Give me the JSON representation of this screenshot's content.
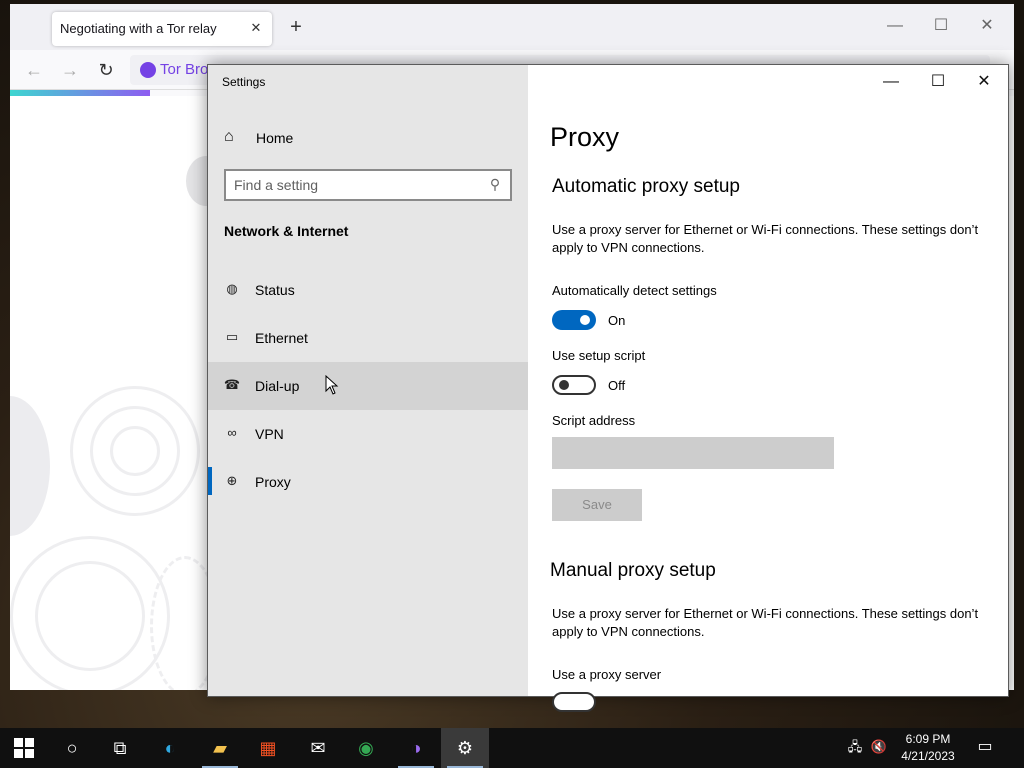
{
  "browser": {
    "tab_title": "Negotiating with a Tor relay",
    "url_chip": "Tor Bro"
  },
  "settings": {
    "window_title": "Settings",
    "home_label": "Home",
    "search_placeholder": "Find a setting",
    "section_title": "Network & Internet",
    "nav": [
      {
        "label": "Status",
        "icon": "globe-status-icon"
      },
      {
        "label": "Ethernet",
        "icon": "ethernet-icon"
      },
      {
        "label": "Dial-up",
        "icon": "dialup-icon"
      },
      {
        "label": "VPN",
        "icon": "vpn-icon"
      },
      {
        "label": "Proxy",
        "icon": "globe-icon",
        "selected": true
      }
    ],
    "page_title": "Proxy",
    "auto": {
      "heading": "Automatic proxy setup",
      "description": "Use a proxy server for Ethernet or Wi-Fi connections. These settings don’t apply to VPN connections.",
      "detect_label": "Automatically detect settings",
      "detect_state": "On",
      "script_label": "Use setup script",
      "script_state": "Off",
      "address_label": "Script address",
      "address_value": "",
      "save_label": "Save"
    },
    "manual": {
      "heading": "Manual proxy setup",
      "description": "Use a proxy server for Ethernet or Wi-Fi connections. These settings don’t apply to VPN connections.",
      "use_proxy_label": "Use a proxy server"
    }
  },
  "taskbar": {
    "apps": [
      "start-icon",
      "cortana-icon",
      "task-view-icon",
      "edge-icon",
      "file-explorer-icon",
      "store-icon",
      "mail-icon",
      "chrome-icon",
      "tor-browser-icon",
      "settings-icon"
    ],
    "time": "6:09 PM",
    "date": "4/21/2023"
  },
  "colors": {
    "accent": "#0067c0",
    "tor_purple": "#7542e5"
  }
}
